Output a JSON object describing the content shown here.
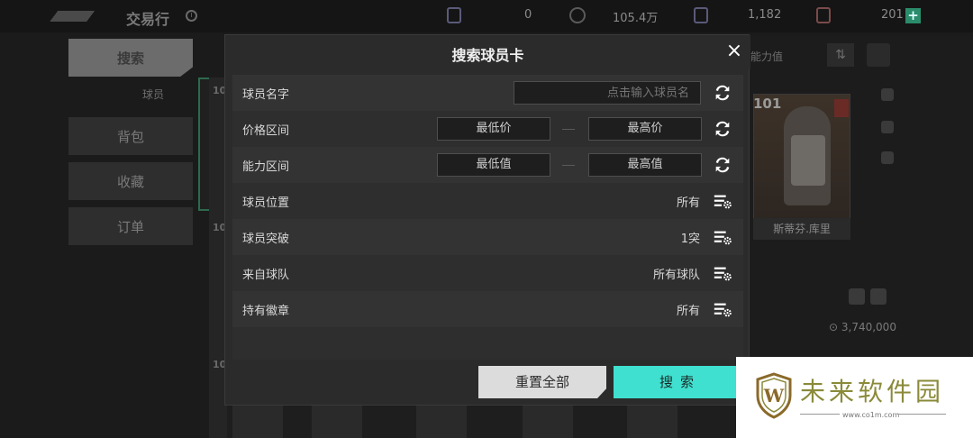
{
  "app": {
    "title": "交易行",
    "currencies": [
      {
        "icon": "ticket-icon",
        "value": "0"
      },
      {
        "icon": "coin-icon",
        "value": "105.4万"
      },
      {
        "icon": "badge-icon",
        "value": "1,182"
      },
      {
        "icon": "card-pack-icon",
        "value": "201"
      }
    ],
    "add_label": "+"
  },
  "sidebar": {
    "items": [
      {
        "label": "搜索",
        "active": true
      },
      {
        "label": "背包",
        "active": false
      },
      {
        "label": "收藏",
        "active": false
      },
      {
        "label": "订单",
        "active": false
      }
    ],
    "sub_label": "球员"
  },
  "background_cards": {
    "ratings": [
      "10",
      "10",
      "10"
    ]
  },
  "right_panel": {
    "sort_label": "能力值",
    "player": {
      "rating": "101",
      "name": "斯蒂芬.库里",
      "flag_value": "1"
    },
    "price": "3,740,000"
  },
  "modal": {
    "title": "搜索球员卡",
    "close_label": "×",
    "rows": [
      {
        "id": "name",
        "label": "球员名字",
        "type": "text",
        "placeholder": "点击输入球员名",
        "action_icon": "refresh-icon"
      },
      {
        "id": "price",
        "label": "价格区间",
        "type": "range",
        "min": "最低价",
        "max": "最高价",
        "action_icon": "refresh-icon"
      },
      {
        "id": "ability",
        "label": "能力区间",
        "type": "range",
        "min": "最低值",
        "max": "最高值",
        "action_icon": "refresh-icon"
      },
      {
        "id": "position",
        "label": "球员位置",
        "type": "select",
        "value": "所有",
        "action_icon": "filter-settings-icon"
      },
      {
        "id": "breakthrough",
        "label": "球员突破",
        "type": "select",
        "value": "1突",
        "action_icon": "filter-settings-icon"
      },
      {
        "id": "team",
        "label": "来自球队",
        "type": "select",
        "value": "所有球队",
        "action_icon": "filter-settings-icon"
      },
      {
        "id": "badge",
        "label": "持有徽章",
        "type": "select",
        "value": "所有",
        "action_icon": "filter-settings-icon"
      }
    ],
    "reset_label": "重置全部",
    "search_label": "搜索"
  },
  "watermark": {
    "text": "未来软件园",
    "url": "www.co1m.com",
    "logo_letter": "W"
  },
  "colors": {
    "accent": "#3fe0cf",
    "modal_bg": "#2b2b2b",
    "row_alt": "#333333",
    "watermark": "#8a8a3a"
  }
}
